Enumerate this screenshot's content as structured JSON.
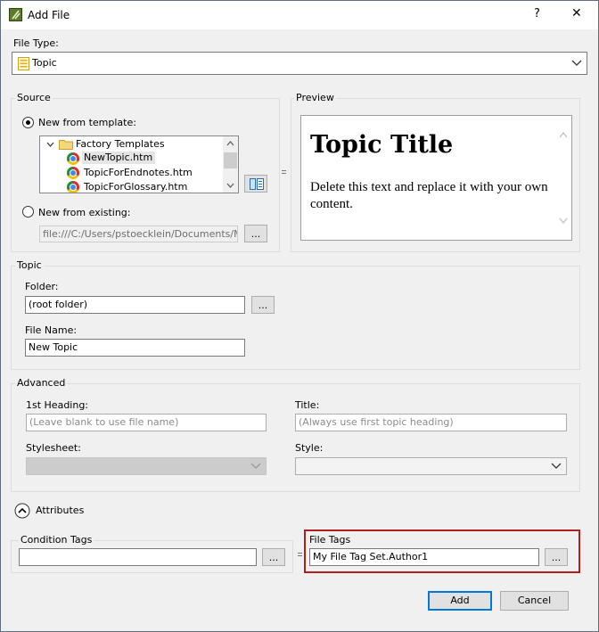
{
  "window": {
    "title": "Add File",
    "help_label": "?",
    "close_label": "✕"
  },
  "file_type": {
    "label": "File Type:",
    "value": "Topic"
  },
  "source": {
    "group_label": "Source",
    "new_from_template": {
      "label": "New from template:",
      "selected": true
    },
    "tree": {
      "folder": "Factory Templates",
      "items": [
        "NewTopic.htm",
        "TopicForEndnotes.htm",
        "TopicForGlossary.htm"
      ],
      "selected_index": 0
    },
    "new_from_existing": {
      "label": "New from existing:",
      "selected": false
    },
    "existing_path": "file:///C:/Users/pstoecklein/Documents/My Pr",
    "browse_label": "..."
  },
  "preview": {
    "group_label": "Preview",
    "heading": "Topic Title",
    "body": "Delete this text and replace it with your own content."
  },
  "topic": {
    "group_label": "Topic",
    "folder_label": "Folder:",
    "folder_value": "(root folder)",
    "browse_label": "...",
    "file_name_label": "File Name:",
    "file_name_value": "New Topic"
  },
  "advanced": {
    "group_label": "Advanced",
    "heading_label": "1st Heading:",
    "heading_placeholder": "(Leave blank to use file name)",
    "title_label": "Title:",
    "title_placeholder": "(Always use first topic heading)",
    "stylesheet_label": "Stylesheet:",
    "style_label": "Style:"
  },
  "attributes": {
    "toggle_label": "Attributes",
    "condition_tags_label": "Condition Tags",
    "condition_tags_value": "",
    "file_tags_label": "File Tags",
    "file_tags_value": "My File Tag Set.Author1",
    "browse_label": "..."
  },
  "footer": {
    "add_label": "Add",
    "cancel_label": "Cancel"
  },
  "colors": {
    "accent": "#0078d7",
    "highlight_border": "#b01e1e",
    "selection": "#e5e5e5"
  }
}
